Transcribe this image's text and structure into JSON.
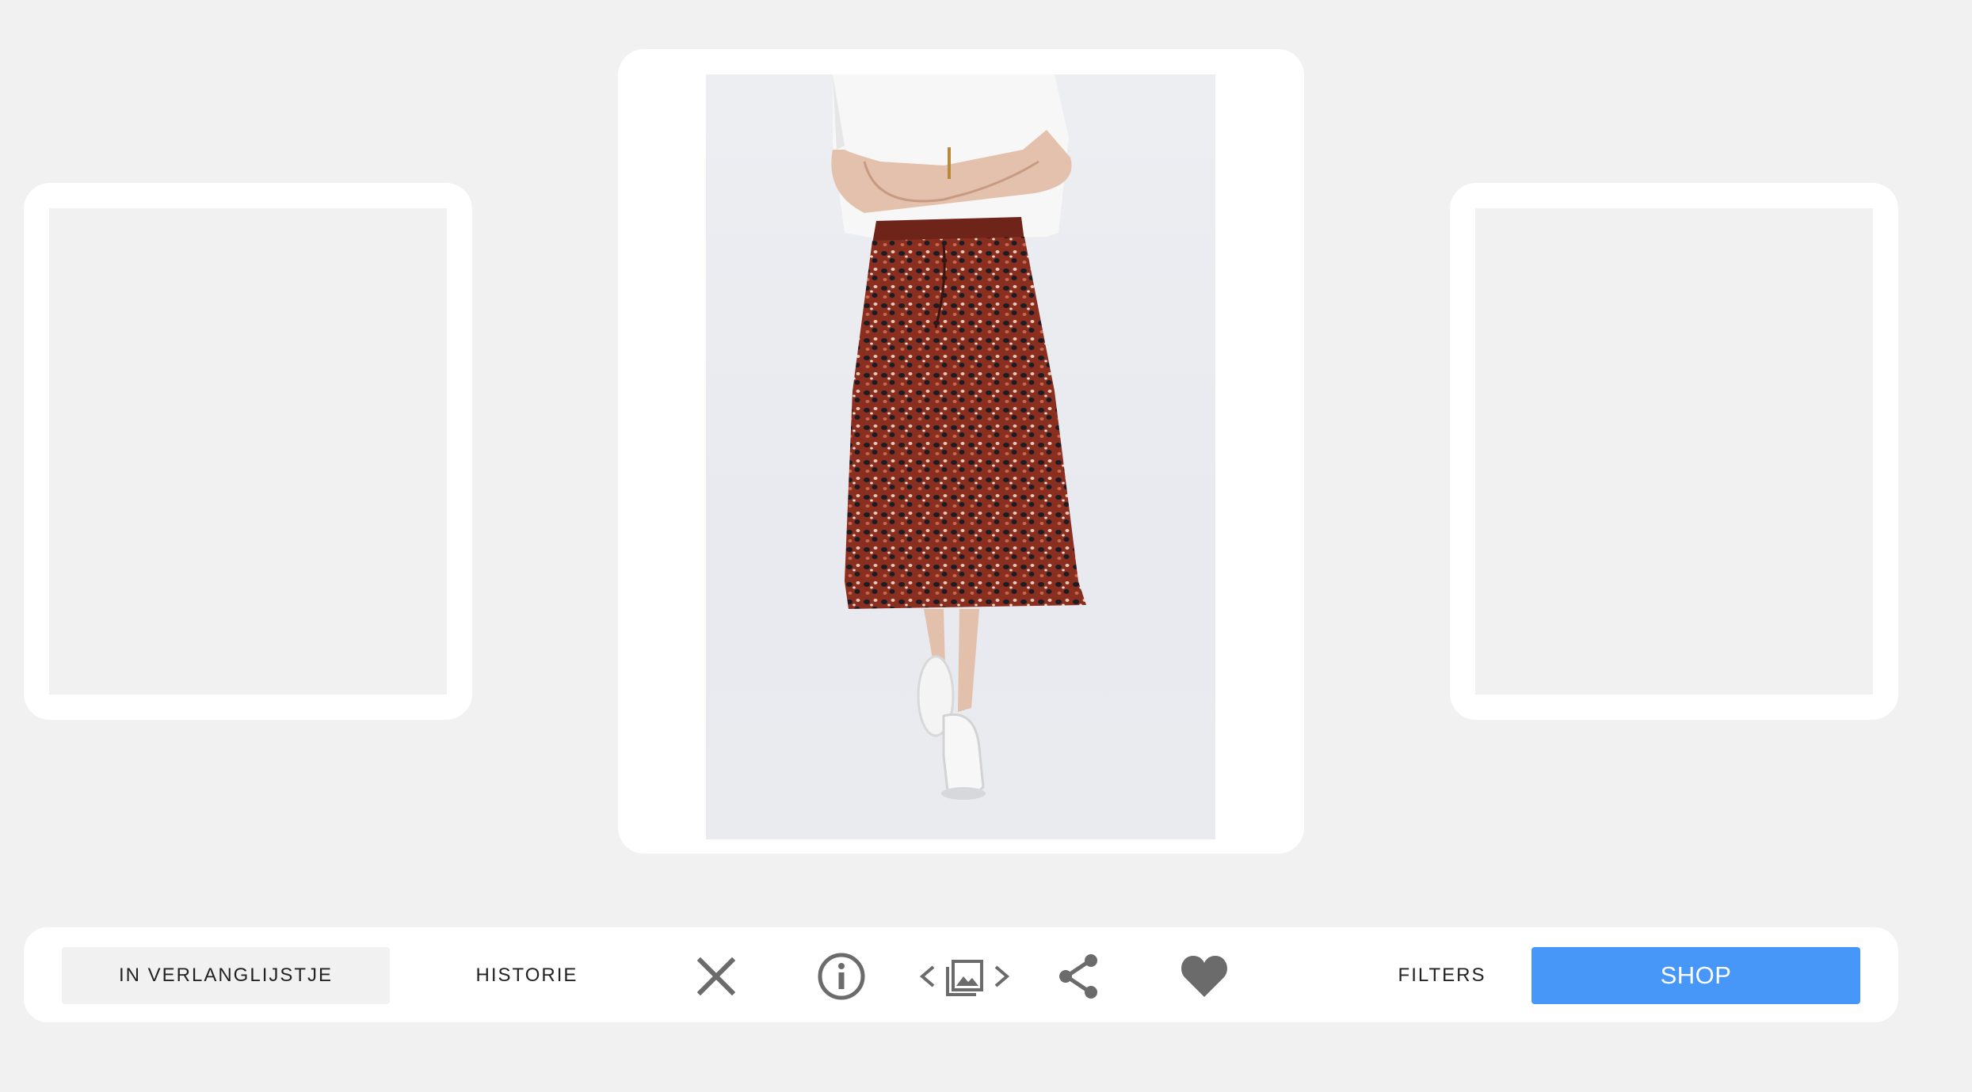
{
  "toolbar": {
    "wishlist_label": "IN VERLANGLIJSTJE",
    "history_label": "HISTORIE",
    "filters_label": "FILTERS",
    "shop_label": "SHOP"
  },
  "icons": {
    "dismiss": "close-icon",
    "info": "info-icon",
    "prev": "chevron-left-icon",
    "gallery": "image-gallery-icon",
    "next": "chevron-right-icon",
    "share": "share-icon",
    "like": "heart-icon"
  },
  "colors": {
    "accent": "#4697f8",
    "icon": "#6b6b6b",
    "background": "#f1f1f1"
  }
}
